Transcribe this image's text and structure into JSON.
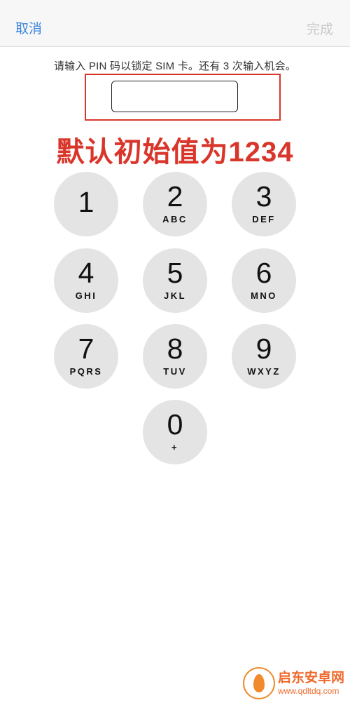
{
  "nav": {
    "cancel": "取消",
    "done": "完成"
  },
  "prompt": "请输入 PIN 码以锁定 SIM 卡。还有 3 次输入机会。",
  "pin": {
    "value": ""
  },
  "annotation": "默认初始值为1234",
  "keypad": [
    {
      "digit": "1",
      "letters": ""
    },
    {
      "digit": "2",
      "letters": "ABC"
    },
    {
      "digit": "3",
      "letters": "DEF"
    },
    {
      "digit": "4",
      "letters": "GHI"
    },
    {
      "digit": "5",
      "letters": "JKL"
    },
    {
      "digit": "6",
      "letters": "MNO"
    },
    {
      "digit": "7",
      "letters": "PQRS"
    },
    {
      "digit": "8",
      "letters": "TUV"
    },
    {
      "digit": "9",
      "letters": "WXYZ"
    },
    {
      "digit": "0",
      "letters": "+"
    }
  ],
  "watermark": {
    "name": "启东安卓网",
    "url": "www.qdltdq.com"
  },
  "colors": {
    "accent": "#3b86d8",
    "disabled": "#c9c9c9",
    "annotation": "#d9362b",
    "key_bg": "#e4e4e4"
  }
}
